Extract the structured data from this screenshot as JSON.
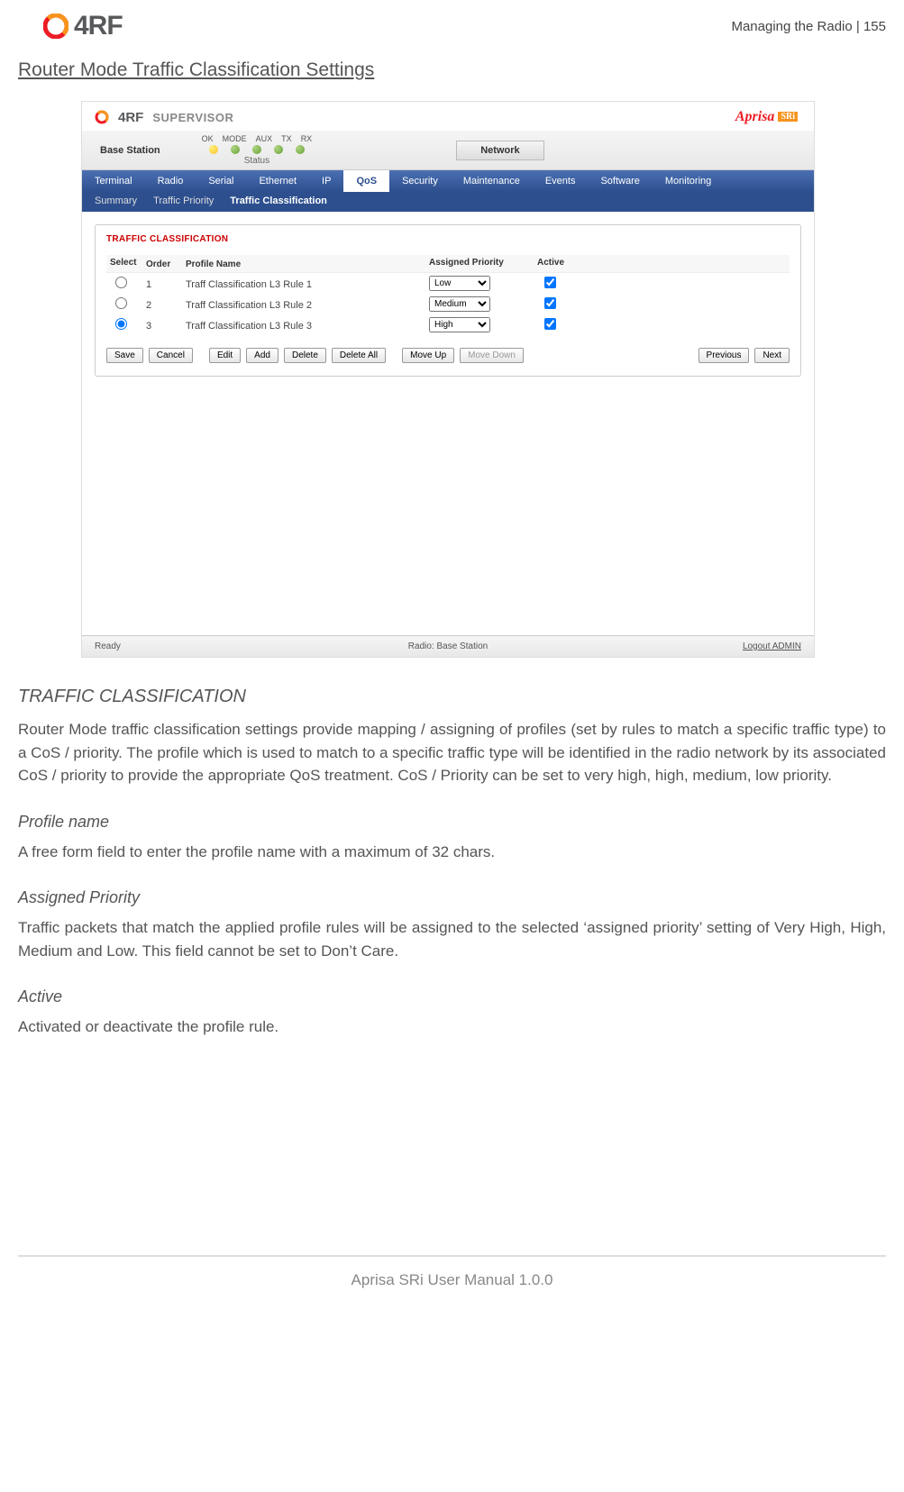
{
  "header": {
    "right_text": "Managing the Radio  |  155",
    "logo_text": "4RF"
  },
  "section_title": "Router Mode Traffic Classification Settings",
  "supervisor": {
    "brand_text": "4RF",
    "brand_sup": "SUPERVISOR",
    "aprisa_a": "Aprisa",
    "aprisa_b": "SRi",
    "base_station": "Base Station",
    "led_labels": [
      "OK",
      "MODE",
      "AUX",
      "TX",
      "RX"
    ],
    "status_label": "Status",
    "network_btn": "Network",
    "tabs": [
      "Terminal",
      "Radio",
      "Serial",
      "Ethernet",
      "IP",
      "QoS",
      "Security",
      "Maintenance",
      "Events",
      "Software",
      "Monitoring"
    ],
    "active_tab": "QoS",
    "subtabs": [
      "Summary",
      "Traffic Priority",
      "Traffic Classification"
    ],
    "active_subtab": "Traffic Classification",
    "panel_title": "TRAFFIC CLASSIFICATION",
    "columns": {
      "select": "Select",
      "order": "Order",
      "profile": "Profile Name",
      "priority": "Assigned Priority",
      "active": "Active"
    },
    "rows": [
      {
        "order": "1",
        "name": "Traff Classification L3 Rule 1",
        "priority": "Low",
        "selected": false,
        "active": true
      },
      {
        "order": "2",
        "name": "Traff Classification L3 Rule 2",
        "priority": "Medium",
        "selected": false,
        "active": true
      },
      {
        "order": "3",
        "name": "Traff Classification L3 Rule 3",
        "priority": "High",
        "selected": true,
        "active": true
      }
    ],
    "priority_options": [
      "Low",
      "Medium",
      "High",
      "Very High"
    ],
    "buttons": {
      "save": "Save",
      "cancel": "Cancel",
      "edit": "Edit",
      "add": "Add",
      "delete": "Delete",
      "delete_all": "Delete All",
      "move_up": "Move Up",
      "move_down": "Move Down",
      "previous": "Previous",
      "next": "Next"
    },
    "footer": {
      "ready": "Ready",
      "radio": "Radio: Base Station",
      "logout": "Logout ADMIN"
    }
  },
  "doc": {
    "h_traffic": "TRAFFIC CLASSIFICATION",
    "p_traffic": "Router Mode traffic classification settings provide mapping / assigning of profiles (set by rules to match a specific traffic type) to a CoS / priority. The profile which is used to match to a specific traffic type will be identified in the radio network by its associated CoS / priority to provide the appropriate QoS treatment. CoS / Priority can be set to very high, high, medium, low priority.",
    "h_profile": "Profile name",
    "p_profile": "A free form field to enter the profile name with a maximum of 32 chars.",
    "h_assigned": "Assigned Priority",
    "p_assigned": "Traffic packets that match the applied profile rules will be assigned to the selected ‘assigned priority’ setting of Very High, High, Medium and Low. This field cannot be set to Don’t Care.",
    "h_active": "Active",
    "p_active": "Activated or deactivate the profile rule."
  },
  "footer_text": "Aprisa SRi User Manual 1.0.0"
}
